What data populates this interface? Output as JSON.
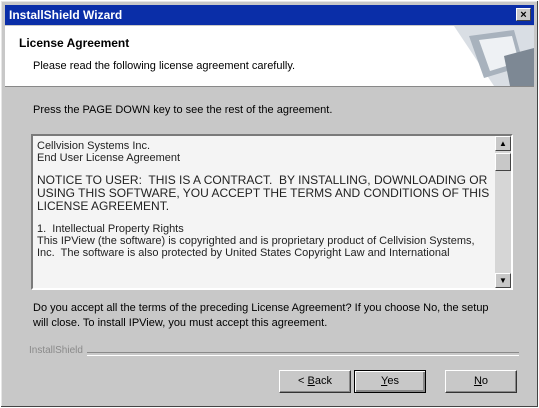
{
  "window": {
    "title": "InstallShield Wizard",
    "close": "×"
  },
  "header": {
    "title": "License Agreement",
    "subtitle": "Please read the following license agreement carefully."
  },
  "instruction": "Press the PAGE DOWN key to see the rest of the agreement.",
  "license": {
    "company": "Cellvision Systems Inc.",
    "doc_title": "End User License Agreement",
    "notice": "NOTICE TO USER:  THIS IS A CONTRACT.  BY INSTALLING, DOWNLOADING OR USING THIS SOFTWARE, YOU ACCEPT THE TERMS AND CONDITIONS OF THIS LICENSE AGREEMENT.",
    "section_heading": "1.  Intellectual Property Rights",
    "section_text": "This IPView (the software) is copyrighted and is proprietary product of Cellvision Systems, Inc.  The software is also protected by United States Copyright Law and International"
  },
  "question": "Do you accept all the terms of the preceding License Agreement?  If you choose No,  the setup will close.  To install IPView, you must accept this agreement.",
  "brand": "InstallShield",
  "buttons": {
    "back": {
      "before": "< ",
      "mnemonic": "B",
      "after": "ack"
    },
    "yes": {
      "mnemonic": "Y",
      "after": "es"
    },
    "no": {
      "mnemonic": "N",
      "after": "o"
    }
  }
}
